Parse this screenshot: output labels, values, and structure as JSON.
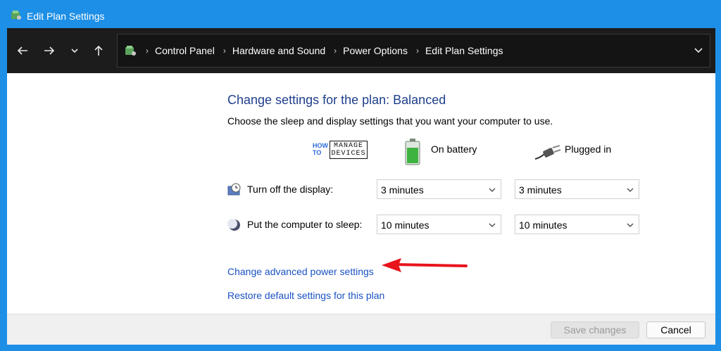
{
  "window": {
    "title": "Edit Plan Settings"
  },
  "breadcrumb": [
    "Control Panel",
    "Hardware and Sound",
    "Power Options",
    "Edit Plan Settings"
  ],
  "main": {
    "heading": "Change settings for the plan: Balanced",
    "subtext": "Choose the sleep and display settings that you want your computer to use.",
    "logo": {
      "how": "HOW",
      "to": "TO",
      "line1": "MANAGE",
      "line2": "DEVICES"
    },
    "columns": {
      "battery": "On battery",
      "plugged": "Plugged in"
    },
    "rows": [
      {
        "label": "Turn off the display:",
        "battery": "3 minutes",
        "plugged": "3 minutes"
      },
      {
        "label": "Put the computer to sleep:",
        "battery": "10 minutes",
        "plugged": "10 minutes"
      }
    ],
    "links": {
      "advanced": "Change advanced power settings",
      "restore": "Restore default settings for this plan"
    }
  },
  "footer": {
    "save": "Save changes",
    "cancel": "Cancel"
  },
  "colors": {
    "titlebar": "#1d8fe6",
    "navbar": "#1c1c1c",
    "heading": "#1e3f8c",
    "link": "#1a52c4",
    "arrow": "#e8141c"
  }
}
